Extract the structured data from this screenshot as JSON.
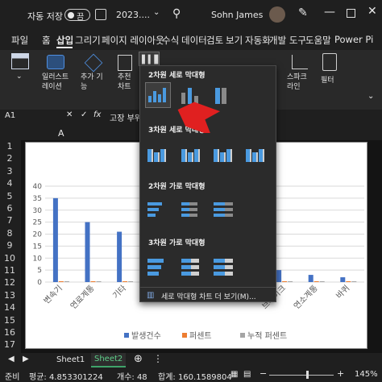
{
  "titlebar": {
    "autosave_label": "자동 저장",
    "autosave_state": "끔",
    "filename": "2023....",
    "username": "Sohn James"
  },
  "menu_tabs": [
    "파일",
    "홈",
    "삽입",
    "그리기",
    "페이지 레이아웃",
    "수식",
    "데이터",
    "검토",
    "보기",
    "자동화",
    "개발 도구",
    "도움말",
    "Power Pi"
  ],
  "active_tab": "삽입",
  "ribbon": {
    "illustrations": "일러스트\n레이션",
    "addins": "추가 기\n능",
    "recommended_charts": "추천\n차트",
    "sparklines": "스파크\n라인",
    "filter": "필터"
  },
  "formula_bar": {
    "name_box": "A1",
    "fx": "fx",
    "content": "고장 부위"
  },
  "columns": [
    "A",
    "B"
  ],
  "rows": [
    "1",
    "2",
    "3",
    "4",
    "5",
    "6",
    "7",
    "8",
    "9",
    "10",
    "11",
    "12",
    "13",
    "14",
    "15",
    "16",
    "17"
  ],
  "dropdown": {
    "sec1": "2차원 세로 막대형",
    "sec2": "3차원 세로 막대형",
    "sec3": "2차원 가로 막대형",
    "sec4": "3차원 가로 막대형",
    "more": "세로 막대형 차트 더 보기(M)..."
  },
  "chart_data": {
    "type": "bar",
    "categories": [
      "변속기",
      "연료계통",
      "기타",
      "전",
      "조향",
      "점",
      "점화",
      "브레이크",
      "연소계통",
      "바퀴"
    ],
    "series": [
      {
        "name": "발생건수",
        "values": [
          35,
          25,
          21,
          18,
          11,
          9,
          7,
          5,
          3,
          2
        ],
        "color": "#4472c4"
      },
      {
        "name": "퍼센트",
        "values": [
          0,
          0,
          0,
          0,
          0,
          0,
          0,
          0,
          0,
          0
        ],
        "color": "#ed7d31"
      },
      {
        "name": "누적 퍼센트",
        "values": [
          0,
          0,
          0,
          0,
          0,
          0,
          0,
          0,
          0,
          0
        ],
        "color": "#a5a5a5"
      }
    ],
    "yticks": [
      0,
      5,
      10,
      15,
      20,
      25,
      30,
      35,
      40
    ],
    "ylim": [
      0,
      40
    ],
    "legend": "bottom"
  },
  "sheets": [
    "Sheet1",
    "Sheet2"
  ],
  "active_sheet": "Sheet2",
  "status": {
    "mode": "준비",
    "average": "평균: 4.853301224",
    "count": "개수: 48",
    "sum": "합계: 160.1589804",
    "zoom": "145%"
  }
}
